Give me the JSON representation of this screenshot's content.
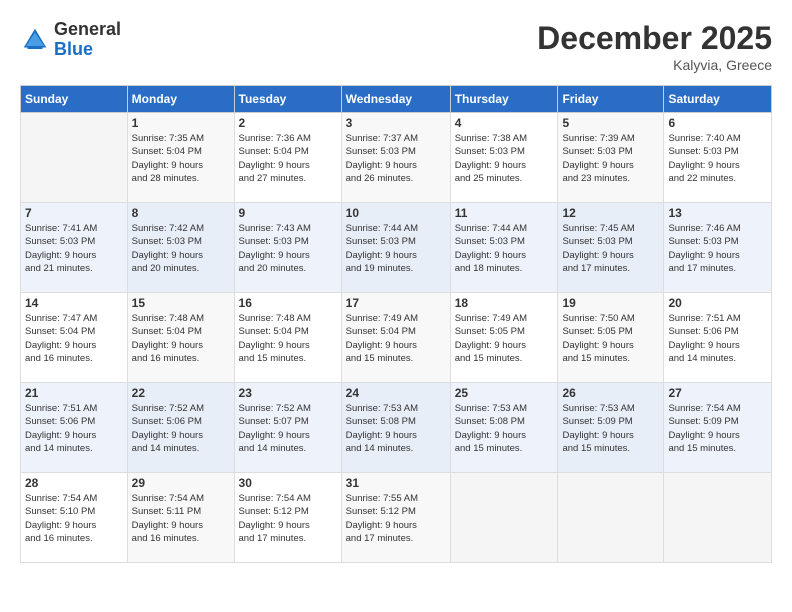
{
  "header": {
    "logo_general": "General",
    "logo_blue": "Blue",
    "title": "December 2025",
    "location": "Kalyvia, Greece"
  },
  "weekdays": [
    "Sunday",
    "Monday",
    "Tuesday",
    "Wednesday",
    "Thursday",
    "Friday",
    "Saturday"
  ],
  "weeks": [
    [
      {
        "day": "",
        "info": ""
      },
      {
        "day": "1",
        "info": "Sunrise: 7:35 AM\nSunset: 5:04 PM\nDaylight: 9 hours\nand 28 minutes."
      },
      {
        "day": "2",
        "info": "Sunrise: 7:36 AM\nSunset: 5:04 PM\nDaylight: 9 hours\nand 27 minutes."
      },
      {
        "day": "3",
        "info": "Sunrise: 7:37 AM\nSunset: 5:03 PM\nDaylight: 9 hours\nand 26 minutes."
      },
      {
        "day": "4",
        "info": "Sunrise: 7:38 AM\nSunset: 5:03 PM\nDaylight: 9 hours\nand 25 minutes."
      },
      {
        "day": "5",
        "info": "Sunrise: 7:39 AM\nSunset: 5:03 PM\nDaylight: 9 hours\nand 23 minutes."
      },
      {
        "day": "6",
        "info": "Sunrise: 7:40 AM\nSunset: 5:03 PM\nDaylight: 9 hours\nand 22 minutes."
      }
    ],
    [
      {
        "day": "7",
        "info": "Sunrise: 7:41 AM\nSunset: 5:03 PM\nDaylight: 9 hours\nand 21 minutes."
      },
      {
        "day": "8",
        "info": "Sunrise: 7:42 AM\nSunset: 5:03 PM\nDaylight: 9 hours\nand 20 minutes."
      },
      {
        "day": "9",
        "info": "Sunrise: 7:43 AM\nSunset: 5:03 PM\nDaylight: 9 hours\nand 20 minutes."
      },
      {
        "day": "10",
        "info": "Sunrise: 7:44 AM\nSunset: 5:03 PM\nDaylight: 9 hours\nand 19 minutes."
      },
      {
        "day": "11",
        "info": "Sunrise: 7:44 AM\nSunset: 5:03 PM\nDaylight: 9 hours\nand 18 minutes."
      },
      {
        "day": "12",
        "info": "Sunrise: 7:45 AM\nSunset: 5:03 PM\nDaylight: 9 hours\nand 17 minutes."
      },
      {
        "day": "13",
        "info": "Sunrise: 7:46 AM\nSunset: 5:03 PM\nDaylight: 9 hours\nand 17 minutes."
      }
    ],
    [
      {
        "day": "14",
        "info": "Sunrise: 7:47 AM\nSunset: 5:04 PM\nDaylight: 9 hours\nand 16 minutes."
      },
      {
        "day": "15",
        "info": "Sunrise: 7:48 AM\nSunset: 5:04 PM\nDaylight: 9 hours\nand 16 minutes."
      },
      {
        "day": "16",
        "info": "Sunrise: 7:48 AM\nSunset: 5:04 PM\nDaylight: 9 hours\nand 15 minutes."
      },
      {
        "day": "17",
        "info": "Sunrise: 7:49 AM\nSunset: 5:04 PM\nDaylight: 9 hours\nand 15 minutes."
      },
      {
        "day": "18",
        "info": "Sunrise: 7:49 AM\nSunset: 5:05 PM\nDaylight: 9 hours\nand 15 minutes."
      },
      {
        "day": "19",
        "info": "Sunrise: 7:50 AM\nSunset: 5:05 PM\nDaylight: 9 hours\nand 15 minutes."
      },
      {
        "day": "20",
        "info": "Sunrise: 7:51 AM\nSunset: 5:06 PM\nDaylight: 9 hours\nand 14 minutes."
      }
    ],
    [
      {
        "day": "21",
        "info": "Sunrise: 7:51 AM\nSunset: 5:06 PM\nDaylight: 9 hours\nand 14 minutes."
      },
      {
        "day": "22",
        "info": "Sunrise: 7:52 AM\nSunset: 5:06 PM\nDaylight: 9 hours\nand 14 minutes."
      },
      {
        "day": "23",
        "info": "Sunrise: 7:52 AM\nSunset: 5:07 PM\nDaylight: 9 hours\nand 14 minutes."
      },
      {
        "day": "24",
        "info": "Sunrise: 7:53 AM\nSunset: 5:08 PM\nDaylight: 9 hours\nand 14 minutes."
      },
      {
        "day": "25",
        "info": "Sunrise: 7:53 AM\nSunset: 5:08 PM\nDaylight: 9 hours\nand 15 minutes."
      },
      {
        "day": "26",
        "info": "Sunrise: 7:53 AM\nSunset: 5:09 PM\nDaylight: 9 hours\nand 15 minutes."
      },
      {
        "day": "27",
        "info": "Sunrise: 7:54 AM\nSunset: 5:09 PM\nDaylight: 9 hours\nand 15 minutes."
      }
    ],
    [
      {
        "day": "28",
        "info": "Sunrise: 7:54 AM\nSunset: 5:10 PM\nDaylight: 9 hours\nand 16 minutes."
      },
      {
        "day": "29",
        "info": "Sunrise: 7:54 AM\nSunset: 5:11 PM\nDaylight: 9 hours\nand 16 minutes."
      },
      {
        "day": "30",
        "info": "Sunrise: 7:54 AM\nSunset: 5:12 PM\nDaylight: 9 hours\nand 17 minutes."
      },
      {
        "day": "31",
        "info": "Sunrise: 7:55 AM\nSunset: 5:12 PM\nDaylight: 9 hours\nand 17 minutes."
      },
      {
        "day": "",
        "info": ""
      },
      {
        "day": "",
        "info": ""
      },
      {
        "day": "",
        "info": ""
      }
    ]
  ]
}
